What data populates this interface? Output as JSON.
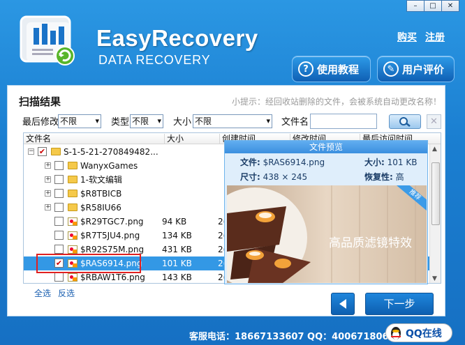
{
  "window": {
    "min_glyph": "–",
    "max_glyph": "□",
    "close_glyph": "✕"
  },
  "header": {
    "brand": "EasyRecovery",
    "subtitle": "DATA RECOVERY",
    "links": [
      "购买",
      "注册"
    ],
    "buttons": [
      {
        "label": "使用教程",
        "icon": "question-icon"
      },
      {
        "label": "用户评价",
        "icon": "comment-icon"
      }
    ]
  },
  "scan": {
    "title": "扫描结果",
    "tip": "小提示：经回收站删除的文件，会被系统自动更改名称！"
  },
  "filters": {
    "modified_label": "最后修改",
    "modified_value": "不限",
    "type_label": "类型",
    "type_value": "不限",
    "size_label": "大小",
    "size_value": "不限",
    "filename_label": "文件名",
    "filename_value": ""
  },
  "table": {
    "columns": [
      "文件名",
      "大小",
      "创建时间",
      "修改时间",
      "最后访问时间"
    ],
    "rows": [
      {
        "name": "S-1-5-21-270849482...",
        "size": "",
        "date": "",
        "checked": true,
        "kind": "folder",
        "level": 0,
        "expander": "−"
      },
      {
        "name": "WanyxGames",
        "size": "",
        "date": "",
        "checked": false,
        "kind": "folder",
        "level": 1,
        "expander": "+"
      },
      {
        "name": "1-软文编辑",
        "size": "",
        "date": "",
        "checked": false,
        "kind": "folder",
        "level": 1,
        "expander": "+"
      },
      {
        "name": "$R8TBICB",
        "size": "",
        "date": "",
        "checked": false,
        "kind": "folder",
        "level": 1,
        "expander": "+"
      },
      {
        "name": "$R58IU66",
        "size": "",
        "date": "",
        "checked": false,
        "kind": "folder",
        "level": 1,
        "expander": "+"
      },
      {
        "name": "$R29TGC7.png",
        "size": "94 KB",
        "date": "2(",
        "checked": false,
        "kind": "file",
        "level": 1,
        "expander": ""
      },
      {
        "name": "$R7T5JU4.png",
        "size": "134 KB",
        "date": "2(",
        "checked": false,
        "kind": "file",
        "level": 1,
        "expander": ""
      },
      {
        "name": "$R92S75M.png",
        "size": "431 KB",
        "date": "2(",
        "checked": false,
        "kind": "file",
        "level": 1,
        "expander": ""
      },
      {
        "name": "$RAS6914.png",
        "size": "101 KB",
        "date": "2(",
        "checked": true,
        "kind": "file",
        "level": 1,
        "expander": "",
        "selected": true
      },
      {
        "name": "$RBAW1T6.png",
        "size": "143 KB",
        "date": "2(",
        "checked": false,
        "kind": "file",
        "level": 1,
        "expander": ""
      }
    ]
  },
  "preview": {
    "title": "文件预览",
    "file_label": "文件:",
    "file_value": "$RAS6914.png",
    "size_label": "大小:",
    "size_value": "101 KB",
    "dims_label": "尺寸:",
    "dims_value": "438 × 245",
    "recover_label": "恢复性:",
    "recover_value": "高",
    "image_text": "高品质滤镜特效",
    "ribbon": "推荐"
  },
  "footer": {
    "select_all": "全选",
    "invert": "反选",
    "next": "下一步",
    "contact": "客服电话：18667133607  QQ：4006718068",
    "qq": "QQ在线"
  },
  "colors": {
    "brand_blue": "#1b7fd1",
    "selected_row": "#3398e5",
    "highlight_box": "#e02020"
  }
}
